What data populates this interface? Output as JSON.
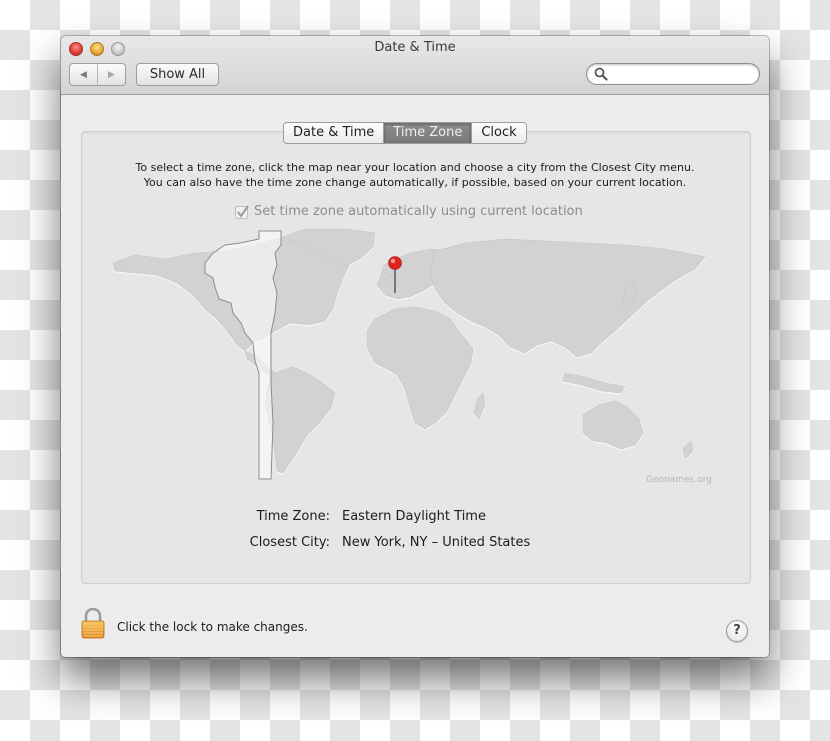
{
  "window": {
    "title": "Date & Time",
    "traffic_lights": [
      "close",
      "minimize",
      "zoom"
    ]
  },
  "toolbar": {
    "back_icon": "◀",
    "forward_icon": "▶",
    "show_all_label": "Show All",
    "search": {
      "value": "",
      "placeholder": ""
    }
  },
  "tabs": [
    {
      "label": "Date & Time",
      "active": false
    },
    {
      "label": "Time Zone",
      "active": true
    },
    {
      "label": "Clock",
      "active": false
    }
  ],
  "instructions": {
    "line1": "To select a time zone, click the map near your location and choose a city from the Closest City menu.",
    "line2": "You can also have the time zone change automatically, if possible, based on your current location."
  },
  "auto_timezone": {
    "label": "Set time zone automatically using current location",
    "checked": true,
    "enabled": false
  },
  "map": {
    "attribution": "Geonames.org",
    "pin_color": "#e0231c",
    "selected_zone": "Eastern Daylight Time"
  },
  "info": {
    "time_zone_label": "Time Zone:",
    "time_zone_value": "Eastern Daylight Time",
    "closest_city_label": "Closest City:",
    "closest_city_value": "New York, NY – United States"
  },
  "footer": {
    "lock_text": "Click the lock to make changes.",
    "help_label": "?"
  }
}
